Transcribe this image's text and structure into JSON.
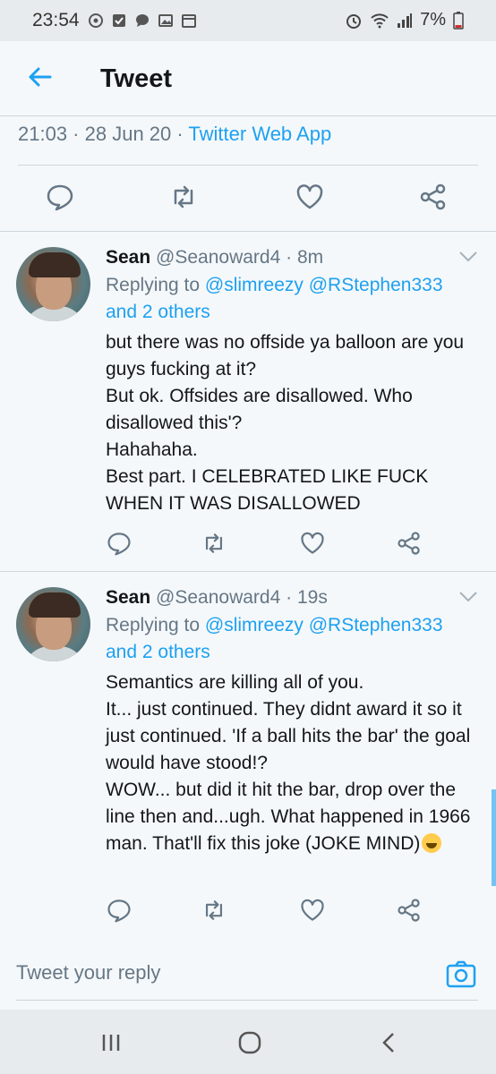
{
  "status_bar": {
    "time": "23:54",
    "battery": "7%"
  },
  "header": {
    "title": "Tweet"
  },
  "tweet_meta": {
    "time": "21:03",
    "sep1": " · ",
    "date": "28 Jun 20",
    "sep2": " · ",
    "app": "Twitter Web App"
  },
  "replies": [
    {
      "name": "Sean",
      "handle": "@Seanoward4",
      "age": "8m",
      "replying_prefix": "Replying to ",
      "mentions": "@slimreezy @RStephen333",
      "others": "and 2 others",
      "body": "but there was no offside ya balloon are you guys fucking at it?\nBut ok. Offsides are disallowed. Who disallowed this'?\nHahahaha.\nBest part. I CELEBRATED LIKE FUCK WHEN IT WAS DISALLOWED"
    },
    {
      "name": "Sean",
      "handle": "@Seanoward4",
      "age": "19s",
      "replying_prefix": "Replying to ",
      "mentions": "@slimreezy @RStephen333",
      "others": "and 2 others",
      "body": "Semantics are killing all of you.\nIt... just continued. They didnt award it so it just continued. 'If a ball hits the bar' the goal would have stood!?\nWOW... but did it hit the bar, drop over the line then and...ugh. What happened in 1966 man. That'll fix this joke (JOKE MIND)"
    }
  ],
  "reply_bar": {
    "placeholder": "Tweet your reply"
  },
  "colors": {
    "accent": "#1da1f2",
    "secondary_text": "#657786",
    "background": "#f5f8fa"
  },
  "icons": [
    "back-arrow-icon",
    "reply-icon",
    "retweet-icon",
    "like-icon",
    "share-icon",
    "chevron-down-icon",
    "camera-icon",
    "recents-icon",
    "home-icon",
    "back-nav-icon"
  ]
}
